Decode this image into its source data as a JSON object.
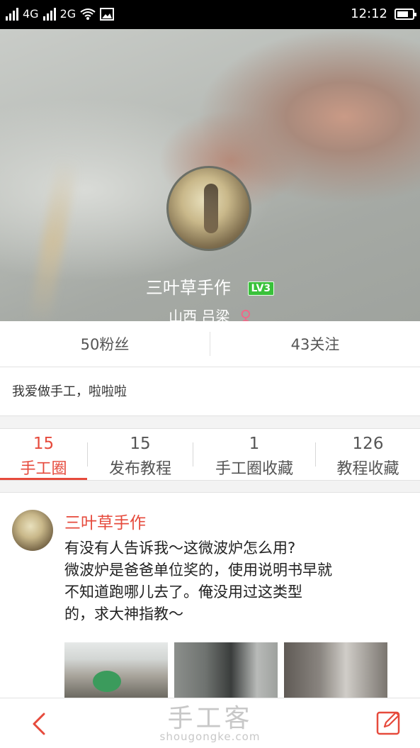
{
  "status_bar": {
    "signal1": "4G",
    "signal2": "2G",
    "time": "12:12",
    "battery_level": 0.75
  },
  "profile": {
    "name": "三叶草手作",
    "level": "LV3",
    "location": "山西  吕梁",
    "gender_symbol": "♀"
  },
  "stats": {
    "fans": "50粉丝",
    "following": "43关注"
  },
  "bio": "我爱做手工，啦啦啦",
  "tabs": [
    {
      "count": "15",
      "label": "手工圈",
      "active": true
    },
    {
      "count": "15",
      "label": "发布教程"
    },
    {
      "count": "1",
      "label": "手工圈收藏"
    },
    {
      "count": "126",
      "label": "教程收藏"
    }
  ],
  "post": {
    "author": "三叶草手作",
    "lines": [
      "有没有人告诉我～这微波炉怎么用?",
      "微波炉是爸爸单位奖的，使用说明书早就",
      "不知道跑哪儿去了。俺没用过这类型",
      "的，求大神指教～"
    ]
  },
  "watermark": {
    "logo": "手工客",
    "url": "shougongke.com"
  },
  "colors": {
    "accent": "#e64a3c",
    "level_badge": "#39c13a",
    "gender": "#f06888"
  }
}
